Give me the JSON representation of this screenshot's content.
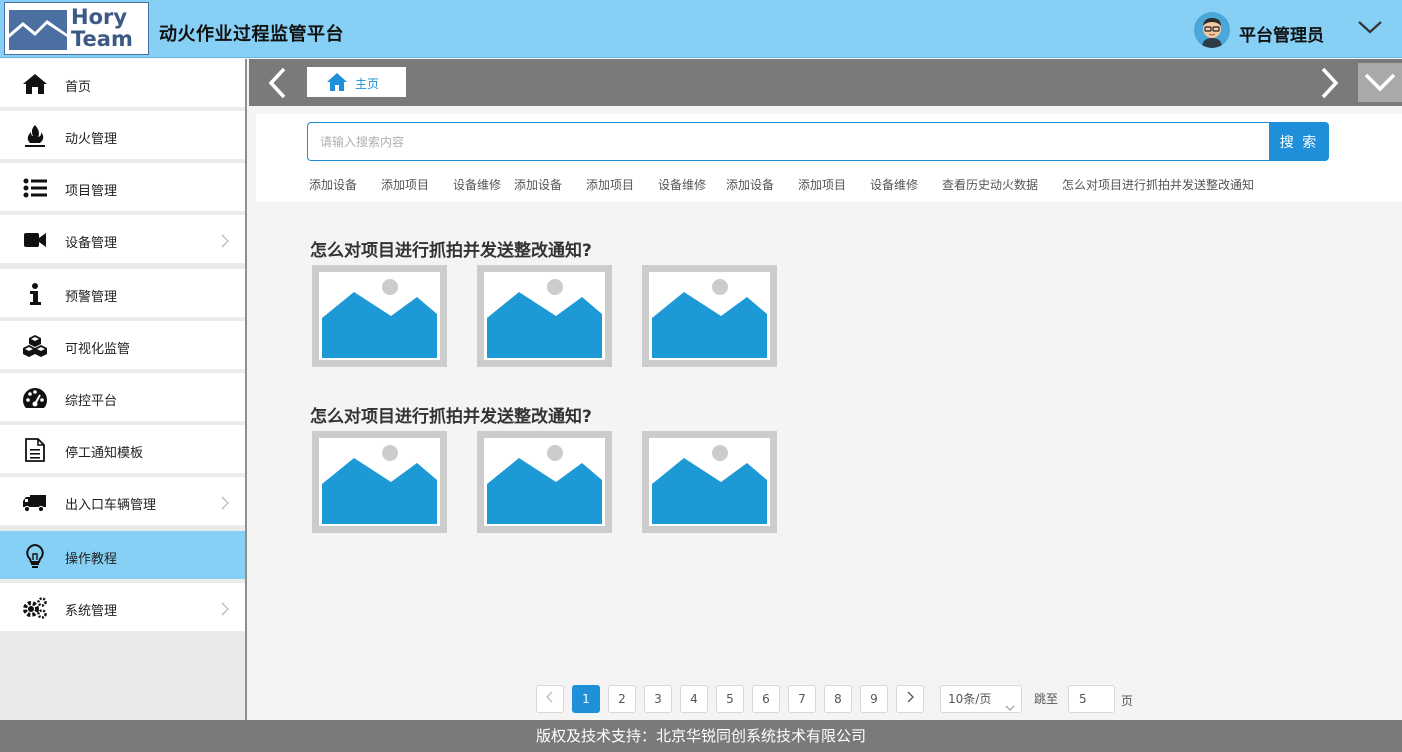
{
  "header": {
    "logo_line1": "Hory",
    "logo_line2": "Team",
    "app_title": "动火作业过程监管平台",
    "user_name": "平台管理员"
  },
  "sidebar": {
    "items": [
      {
        "label": "首页",
        "icon": "home-icon",
        "has_arrow": false
      },
      {
        "label": "动火管理",
        "icon": "fire-icon",
        "has_arrow": false
      },
      {
        "label": "项目管理",
        "icon": "list-icon",
        "has_arrow": false
      },
      {
        "label": "设备管理",
        "icon": "video-camera-icon",
        "has_arrow": true
      },
      {
        "label": "预警管理",
        "icon": "info-icon",
        "has_arrow": false
      },
      {
        "label": "可视化监管",
        "icon": "cubes-icon",
        "has_arrow": false
      },
      {
        "label": "综控平台",
        "icon": "dashboard-icon",
        "has_arrow": false
      },
      {
        "label": "停工通知模板",
        "icon": "document-icon",
        "has_arrow": false
      },
      {
        "label": "出入口车辆管理",
        "icon": "truck-icon",
        "has_arrow": true
      },
      {
        "label": "操作教程",
        "icon": "lightbulb-icon",
        "has_arrow": false,
        "active": true
      },
      {
        "label": "系统管理",
        "icon": "gears-icon",
        "has_arrow": true
      }
    ]
  },
  "tabs": {
    "home_label": "主页"
  },
  "search": {
    "placeholder": "请输入搜索内容",
    "value": "",
    "button_label": "搜 索",
    "quick_links": [
      "添加设备",
      "添加项目",
      "设备维修",
      "添加设备",
      "添加项目",
      "设备维修",
      "添加设备",
      "添加项目",
      "设备维修",
      "查看历史动火数据",
      "怎么对项目进行抓拍并发送整改通知"
    ]
  },
  "content": {
    "sections": [
      {
        "title": "怎么对项目进行抓拍并发送整改通知?",
        "thumbnail_count": 3
      },
      {
        "title": "怎么对项目进行抓拍并发送整改通知?",
        "thumbnail_count": 3
      }
    ]
  },
  "pagination": {
    "pages": [
      "1",
      "2",
      "3",
      "4",
      "5",
      "6",
      "7",
      "8",
      "9"
    ],
    "current": "1",
    "page_size": "10条/页",
    "jump_label": "跳至",
    "jump_value": "5",
    "page_suffix": "页"
  },
  "footer": {
    "text": "版权及技术支持：北京华锐同创系统技术有限公司"
  },
  "colors": {
    "header_bg": "#87d0f5",
    "accent": "#1e8fd8",
    "active_nav": "#87d0f5",
    "bar_gray": "#7a7a7a"
  }
}
